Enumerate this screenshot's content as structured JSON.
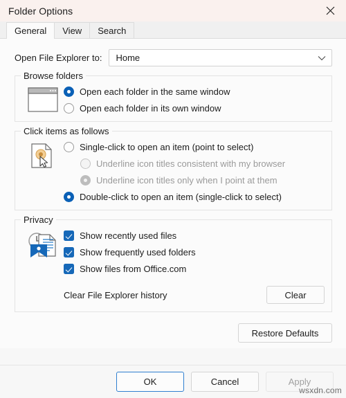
{
  "window": {
    "title": "Folder Options",
    "close_icon": "close-icon",
    "titlebar_color": "#faf1ee"
  },
  "tabs": [
    {
      "label": "General",
      "active": true
    },
    {
      "label": "View",
      "active": false
    },
    {
      "label": "Search",
      "active": false
    }
  ],
  "open_explorer": {
    "label": "Open File Explorer to:",
    "value": "Home",
    "chevron_icon": "chevron-down-icon"
  },
  "browse_folders": {
    "legend": "Browse folders",
    "icon": "window-icon",
    "options": [
      {
        "label": "Open each folder in the same window",
        "checked": true,
        "disabled": false
      },
      {
        "label": "Open each folder in its own window",
        "checked": false,
        "disabled": false
      }
    ]
  },
  "click_items": {
    "legend": "Click items as follows",
    "icon": "document-click-icon",
    "options": [
      {
        "label": "Single-click to open an item (point to select)",
        "checked": false,
        "disabled": false,
        "sub": false
      },
      {
        "label": "Underline icon titles consistent with my browser",
        "checked": false,
        "disabled": true,
        "sub": true
      },
      {
        "label": "Underline icon titles only when I point at them",
        "checked": true,
        "disabled": true,
        "sub": true
      },
      {
        "label": "Double-click to open an item (single-click to select)",
        "checked": true,
        "disabled": false,
        "sub": false
      }
    ]
  },
  "privacy": {
    "legend": "Privacy",
    "icon": "recent-files-icon",
    "checkboxes": [
      {
        "label": "Show recently used files",
        "checked": true
      },
      {
        "label": "Show frequently used folders",
        "checked": true
      },
      {
        "label": "Show files from Office.com",
        "checked": true
      }
    ],
    "clear_history_label": "Clear File Explorer history",
    "clear_button": "Clear"
  },
  "restore_defaults_button": "Restore Defaults",
  "footer": {
    "ok": "OK",
    "cancel": "Cancel",
    "apply": "Apply",
    "apply_disabled": true
  },
  "watermark": "wsxdn.com",
  "colors": {
    "accent": "#0a60b6",
    "checkbox_blue": "#1668b8",
    "focus_border": "#2f7fd0",
    "disabled_text": "#9a9a9a"
  }
}
